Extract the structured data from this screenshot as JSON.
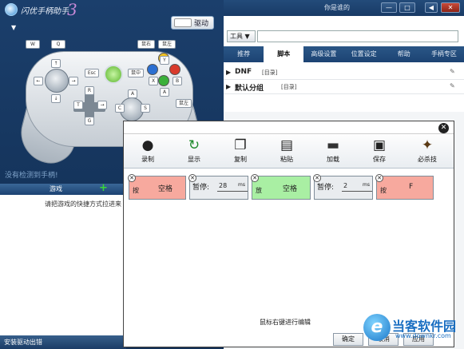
{
  "app": {
    "title": "闪优手柄助手",
    "title_deco": "3",
    "drive_label": "驱动",
    "user_link": "你是谁的",
    "min_btn": "—",
    "restore_btn": "□",
    "mute_btn": "◀",
    "close_btn": "✕"
  },
  "controller": {
    "keys": {
      "lb": "W",
      "lt": "Q",
      "rb": "鼠左",
      "rt": "鼠右",
      "back": "Esc",
      "start": "鼠中",
      "y": "Y",
      "x": "X",
      "b": "B",
      "a": "A",
      "lstick_up": "↑",
      "lstick_left": "←",
      "lstick_right": "→",
      "lstick_down": "↓",
      "dpad_up": "R",
      "dpad_left": "T",
      "dpad_right": "→",
      "dpad_down": "G",
      "rs_up": "A",
      "rs_left": "C",
      "rs_right": "S",
      "rs_down": "V",
      "extra": "鼠左"
    }
  },
  "left": {
    "tip": "没有检测到手柄!",
    "games_header": "游戏",
    "games_add": "+",
    "games_hint": "请把游戏的快捷方式拉进来",
    "status": "安装驱动出错"
  },
  "toolbar": {
    "tools_label": "工具 ▼"
  },
  "tabs": [
    "推荐",
    "脚本",
    "高级设置",
    "位置设定",
    "帮助",
    "手柄专区"
  ],
  "active_tab": 1,
  "scripts": [
    {
      "name": "DNF",
      "category": "[目录]"
    },
    {
      "name": "默认分组",
      "category": "[目录]"
    }
  ],
  "dialog": {
    "toolbar": [
      {
        "icon": "record-icon",
        "label": "录制",
        "glyph": "●",
        "color": "#222"
      },
      {
        "icon": "refresh-icon",
        "label": "显示",
        "glyph": "↻",
        "color": "#1d8a2a"
      },
      {
        "icon": "copy-icon",
        "label": "复制",
        "glyph": "❐",
        "color": "#222"
      },
      {
        "icon": "paste-icon",
        "label": "粘贴",
        "glyph": "▤",
        "color": "#222"
      },
      {
        "icon": "folder-icon",
        "label": "加载",
        "glyph": "▬",
        "color": "#333"
      },
      {
        "icon": "save-icon",
        "label": "保存",
        "glyph": "▣",
        "color": "#222"
      },
      {
        "icon": "ninja-icon",
        "label": "必杀技",
        "glyph": "✦",
        "color": "#5b3a14"
      }
    ],
    "actions": [
      {
        "type": "press",
        "kind": "按",
        "value": "空格"
      },
      {
        "type": "pause",
        "label": "暂停:",
        "value": "28",
        "unit": "ms"
      },
      {
        "type": "release",
        "kind": "放",
        "value": "空格"
      },
      {
        "type": "pause",
        "label": "暂停:",
        "value": "2",
        "unit": "ms"
      },
      {
        "type": "press",
        "kind": "按",
        "value": "F"
      }
    ],
    "hint": "鼠标右键进行编辑",
    "ok": "确定",
    "cancel": "取消",
    "apply": "应用"
  },
  "watermark": {
    "badge": "e",
    "text": "当客软件园",
    "url": "www.downkr.com"
  }
}
